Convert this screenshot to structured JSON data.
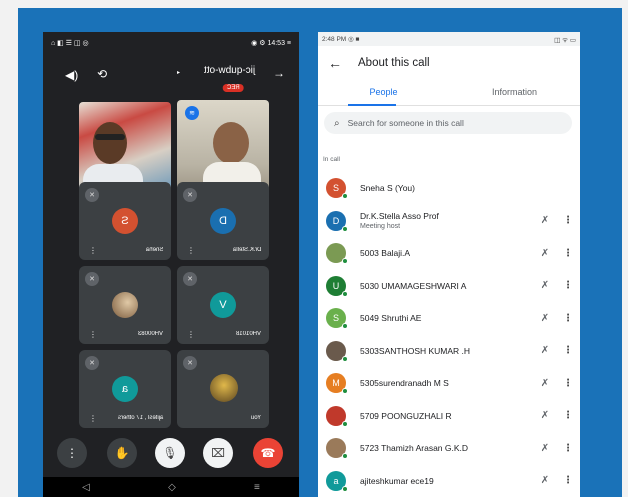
{
  "left_phone": {
    "status_bar": {
      "left": "⌂ ◧ ☰ ◫ ◎",
      "right": "◉ ⚙ 14:53 ≡"
    },
    "meeting_code": "jic-qubw-ott",
    "rec_badge": "REC",
    "tiles": [
      {
        "name": "Sneha",
        "initial": "S",
        "color": "#d35130"
      },
      {
        "name": "Dr.K.Stella",
        "initial": "D",
        "color": "#1a6fb0"
      },
      {
        "name": "VH00083",
        "initial": "",
        "color": "#8c6a45"
      },
      {
        "name": "VH01018",
        "initial": "V",
        "color": "#109a9a"
      },
      {
        "name": "ajitesl , 17 others",
        "initial": "a",
        "color": "#109a9a"
      },
      {
        "name": "You",
        "initial": "",
        "color": "#6b5a2c"
      }
    ],
    "nav": {
      "back": "◁",
      "home": "◇",
      "menu": "≡"
    }
  },
  "right_phone": {
    "status_bar": {
      "left": "2:48 PM ◎ ■",
      "right": "◫ ᯤ ▭"
    },
    "title": "About this call",
    "tabs": [
      "People",
      "Information"
    ],
    "search_placeholder": "Search for someone in this call",
    "section_label": "In call",
    "participants": [
      {
        "name": "Sneha S (You)",
        "sub": "",
        "initial": "S",
        "color": "#d35130",
        "show_controls": false
      },
      {
        "name": "Dr.K.Stella Asso Prof",
        "sub": "Meeting host",
        "initial": "D",
        "color": "#1a6fb0",
        "show_controls": true
      },
      {
        "name": "5003 Balaji.A",
        "sub": "",
        "initial": "",
        "color": "#7b9a53",
        "show_controls": true
      },
      {
        "name": "5030 UMAMAGESHWARI A",
        "sub": "",
        "initial": "U",
        "color": "#1e7e34",
        "show_controls": true
      },
      {
        "name": "5049 Shruthi AE",
        "sub": "",
        "initial": "S",
        "color": "#6ab04c",
        "show_controls": true
      },
      {
        "name": "5303SANTHOSH KUMAR .H",
        "sub": "",
        "initial": "",
        "color": "#6a5a4c",
        "show_controls": true
      },
      {
        "name": "5305surendranadh M S",
        "sub": "",
        "initial": "M",
        "color": "#e67e22",
        "show_controls": true
      },
      {
        "name": "5709 POONGUZHALI R",
        "sub": "",
        "initial": "",
        "color": "#c0392b",
        "show_controls": true
      },
      {
        "name": "5723 Thamizh Arasan G.K.D",
        "sub": "",
        "initial": "",
        "color": "#9a7a5a",
        "show_controls": true
      },
      {
        "name": "ajiteshkumar ece19",
        "sub": "",
        "initial": "a",
        "color": "#109a9a",
        "show_controls": true
      }
    ]
  }
}
